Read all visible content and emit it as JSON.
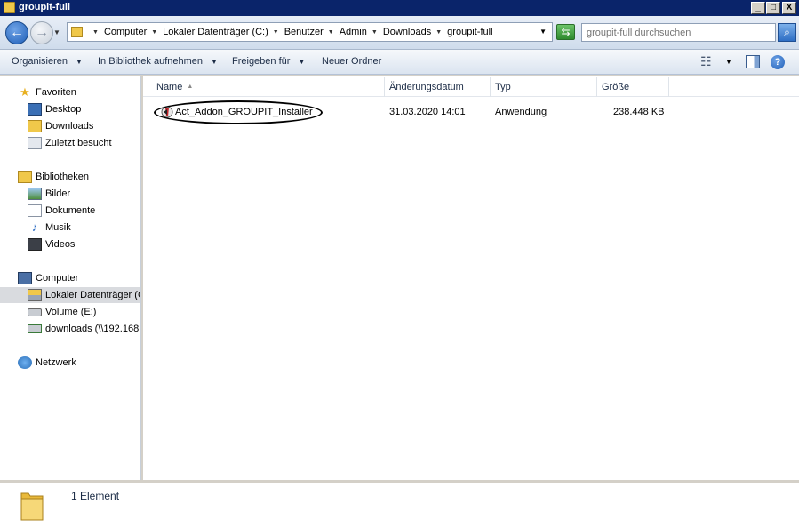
{
  "window": {
    "title": "groupit-full"
  },
  "title_buttons": {
    "minimize": "_",
    "maximize": "□",
    "close": "X"
  },
  "address": {
    "crumbs": [
      "Computer",
      "Lokaler Datenträger (C:)",
      "Benutzer",
      "Admin",
      "Downloads",
      "groupit-full"
    ],
    "search_placeholder": "groupit-full durchsuchen"
  },
  "toolbar": {
    "organize": "Organisieren",
    "library": "In Bibliothek aufnehmen",
    "share": "Freigeben für",
    "new_folder": "Neuer Ordner",
    "help": "?"
  },
  "sidebar": {
    "favorites": {
      "label": "Favoriten",
      "items": [
        "Desktop",
        "Downloads",
        "Zuletzt besucht"
      ]
    },
    "libraries": {
      "label": "Bibliotheken",
      "items": [
        "Bilder",
        "Dokumente",
        "Musik",
        "Videos"
      ]
    },
    "computer": {
      "label": "Computer",
      "items": [
        "Lokaler Datenträger (C",
        "Volume (E:)",
        "downloads (\\\\192.168"
      ]
    },
    "network": {
      "label": "Netzwerk"
    }
  },
  "columns": [
    "Name",
    "Änderungsdatum",
    "Typ",
    "Größe"
  ],
  "files": [
    {
      "name": "Act_Addon_GROUPIT_Installer",
      "date": "31.03.2020 14:01",
      "type": "Anwendung",
      "size": "238.448 KB"
    }
  ],
  "status": {
    "count": "1 Element"
  },
  "colors": {
    "titlebar": "#0a246a",
    "selected": "#d9dbdf",
    "folder": "#f0c84a"
  }
}
